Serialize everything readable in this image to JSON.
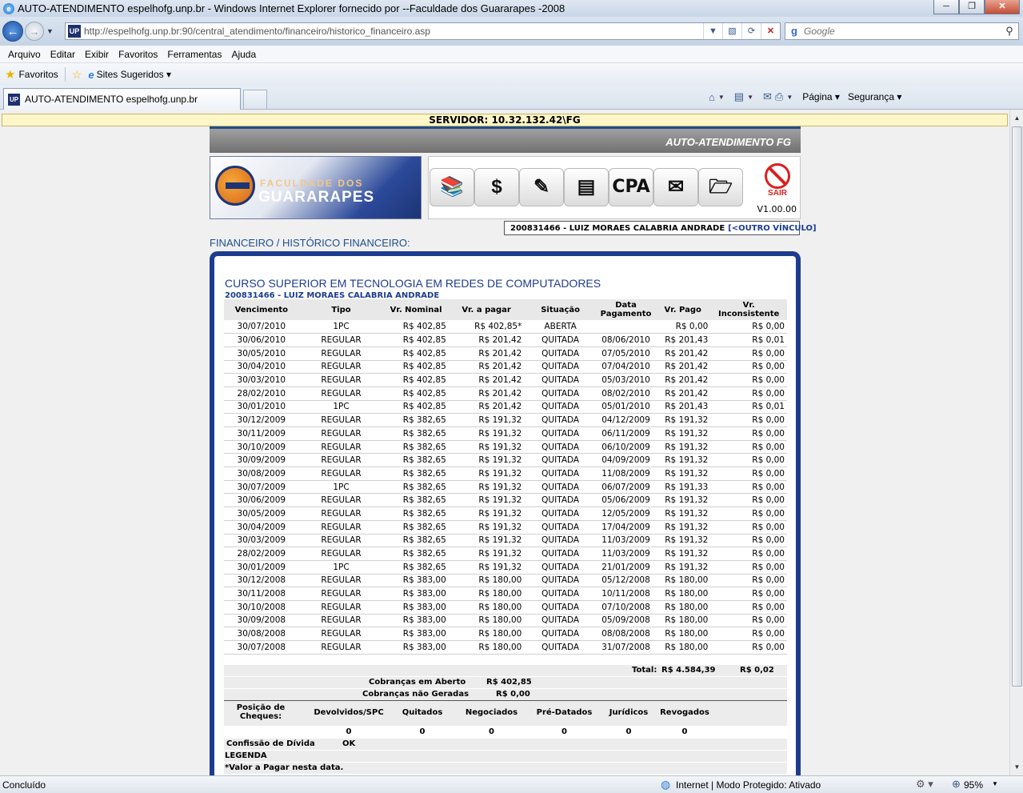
{
  "window": {
    "title": "AUTO-ATENDIMENTO espelhofg.unp.br - Windows Internet Explorer fornecido por --Faculdade dos Guararapes -2008",
    "app_icon": "ie-icon",
    "min": "─",
    "max": "❐",
    "close": "✕"
  },
  "address": {
    "url": "http://espelhofg.unp.br:90/central_atendimento/financeiro/historico_financeiro.asp",
    "site_icon_text": "UP",
    "search_placeholder": "Google"
  },
  "menu": [
    "Arquivo",
    "Editar",
    "Exibir",
    "Favoritos",
    "Ferramentas",
    "Ajuda"
  ],
  "favorites": {
    "label": "Favoritos",
    "suggested": "Sites Sugeridos ▾"
  },
  "tab": {
    "title": "AUTO-ATENDIMENTO espelhofg.unp.br",
    "icon_text": "UP"
  },
  "commands": {
    "pagina": "Página ▾",
    "seguranca": "Segurança ▾"
  },
  "page": {
    "servidor": "SERVIDOR: 10.32.132.42\\FG",
    "header_title": "AUTO-ATENDIMENTO FG",
    "logo_line1": "FACULDADE DOS",
    "logo_line2": "GUARARAPES",
    "version": "V1.00.00",
    "sair_label": "SAIR",
    "cpa_label": "CPA",
    "user_text": "200831466 - LUIZ MORAES CALABRIA ANDRADE",
    "outro_vinculo": "[<OUTRO VÍNCULO]",
    "section_title": "FINANCEIRO / HISTÓRICO FINANCEIRO:",
    "course": "CURSO SUPERIOR EM TECNOLOGIA EM REDES DE COMPUTADORES",
    "student": "200831466 - LUIZ MORAES CALABRIA ANDRADE"
  },
  "table": {
    "headers": [
      "Vencimento",
      "Tipo",
      "Vr. Nominal",
      "Vr. a pagar",
      "Situação",
      "Data Pagamento",
      "Vr. Pago",
      "Vr. Inconsistente"
    ],
    "rows": [
      [
        "30/07/2010",
        "1PC",
        "R$ 402,85",
        "R$ 402,85*",
        "ABERTA",
        "",
        "R$ 0,00",
        "R$ 0,00"
      ],
      [
        "30/06/2010",
        "REGULAR",
        "R$ 402,85",
        "R$ 201,42",
        "QUITADA",
        "08/06/2010",
        "R$ 201,43",
        "R$ 0,01"
      ],
      [
        "30/05/2010",
        "REGULAR",
        "R$ 402,85",
        "R$ 201,42",
        "QUITADA",
        "07/05/2010",
        "R$ 201,42",
        "R$ 0,00"
      ],
      [
        "30/04/2010",
        "REGULAR",
        "R$ 402,85",
        "R$ 201,42",
        "QUITADA",
        "07/04/2010",
        "R$ 201,42",
        "R$ 0,00"
      ],
      [
        "30/03/2010",
        "REGULAR",
        "R$ 402,85",
        "R$ 201,42",
        "QUITADA",
        "05/03/2010",
        "R$ 201,42",
        "R$ 0,00"
      ],
      [
        "28/02/2010",
        "REGULAR",
        "R$ 402,85",
        "R$ 201,42",
        "QUITADA",
        "08/02/2010",
        "R$ 201,42",
        "R$ 0,00"
      ],
      [
        "30/01/2010",
        "1PC",
        "R$ 402,85",
        "R$ 201,42",
        "QUITADA",
        "05/01/2010",
        "R$ 201,43",
        "R$ 0,01"
      ],
      [
        "30/12/2009",
        "REGULAR",
        "R$ 382,65",
        "R$ 191,32",
        "QUITADA",
        "04/12/2009",
        "R$ 191,32",
        "R$ 0,00"
      ],
      [
        "30/11/2009",
        "REGULAR",
        "R$ 382,65",
        "R$ 191,32",
        "QUITADA",
        "06/11/2009",
        "R$ 191,32",
        "R$ 0,00"
      ],
      [
        "30/10/2009",
        "REGULAR",
        "R$ 382,65",
        "R$ 191,32",
        "QUITADA",
        "06/10/2009",
        "R$ 191,32",
        "R$ 0,00"
      ],
      [
        "30/09/2009",
        "REGULAR",
        "R$ 382,65",
        "R$ 191,32",
        "QUITADA",
        "04/09/2009",
        "R$ 191,32",
        "R$ 0,00"
      ],
      [
        "30/08/2009",
        "REGULAR",
        "R$ 382,65",
        "R$ 191,32",
        "QUITADA",
        "11/08/2009",
        "R$ 191,32",
        "R$ 0,00"
      ],
      [
        "30/07/2009",
        "1PC",
        "R$ 382,65",
        "R$ 191,32",
        "QUITADA",
        "06/07/2009",
        "R$ 191,33",
        "R$ 0,00"
      ],
      [
        "30/06/2009",
        "REGULAR",
        "R$ 382,65",
        "R$ 191,32",
        "QUITADA",
        "05/06/2009",
        "R$ 191,32",
        "R$ 0,00"
      ],
      [
        "30/05/2009",
        "REGULAR",
        "R$ 382,65",
        "R$ 191,32",
        "QUITADA",
        "12/05/2009",
        "R$ 191,32",
        "R$ 0,00"
      ],
      [
        "30/04/2009",
        "REGULAR",
        "R$ 382,65",
        "R$ 191,32",
        "QUITADA",
        "17/04/2009",
        "R$ 191,32",
        "R$ 0,00"
      ],
      [
        "30/03/2009",
        "REGULAR",
        "R$ 382,65",
        "R$ 191,32",
        "QUITADA",
        "11/03/2009",
        "R$ 191,32",
        "R$ 0,00"
      ],
      [
        "28/02/2009",
        "REGULAR",
        "R$ 382,65",
        "R$ 191,32",
        "QUITADA",
        "11/03/2009",
        "R$ 191,32",
        "R$ 0,00"
      ],
      [
        "30/01/2009",
        "1PC",
        "R$ 382,65",
        "R$ 191,32",
        "QUITADA",
        "21/01/2009",
        "R$ 191,32",
        "R$ 0,00"
      ],
      [
        "30/12/2008",
        "REGULAR",
        "R$ 383,00",
        "R$ 180,00",
        "QUITADA",
        "05/12/2008",
        "R$ 180,00",
        "R$ 0,00"
      ],
      [
        "30/11/2008",
        "REGULAR",
        "R$ 383,00",
        "R$ 180,00",
        "QUITADA",
        "10/11/2008",
        "R$ 180,00",
        "R$ 0,00"
      ],
      [
        "30/10/2008",
        "REGULAR",
        "R$ 383,00",
        "R$ 180,00",
        "QUITADA",
        "07/10/2008",
        "R$ 180,00",
        "R$ 0,00"
      ],
      [
        "30/09/2008",
        "REGULAR",
        "R$ 383,00",
        "R$ 180,00",
        "QUITADA",
        "05/09/2008",
        "R$ 180,00",
        "R$ 0,00"
      ],
      [
        "30/08/2008",
        "REGULAR",
        "R$ 383,00",
        "R$ 180,00",
        "QUITADA",
        "08/08/2008",
        "R$ 180,00",
        "R$ 0,00"
      ],
      [
        "30/07/2008",
        "REGULAR",
        "R$ 383,00",
        "R$ 180,00",
        "QUITADA",
        "31/07/2008",
        "R$ 180,00",
        "R$ 0,00"
      ]
    ]
  },
  "summary": {
    "total_label": "Total:",
    "total_pago": "R$ 4.584,39",
    "total_inconsistente": "R$ 0,02",
    "em_aberto_label": "Cobranças em Aberto",
    "em_aberto_value": "R$ 402,85",
    "nao_geradas_label": "Cobranças não Geradas",
    "nao_geradas_value": "R$ 0,00",
    "cheques_label": "Posição de Cheques:",
    "cheques_headers": [
      "Devolvidos/SPC",
      "Quitados",
      "Negociados",
      "Pré-Datados",
      "Jurídicos",
      "Revogados"
    ],
    "cheques_values": [
      "0",
      "0",
      "0",
      "0",
      "0",
      "0"
    ],
    "confissao_label": "Confissão de Dívida",
    "confissao_value": "OK",
    "legenda_label": "LEGENDA",
    "legenda_note": "*Valor a Pagar nesta data."
  },
  "statusbar": {
    "status": "Concluído",
    "zone": "Internet | Modo Protegido: Ativado",
    "zoom": "95%"
  }
}
